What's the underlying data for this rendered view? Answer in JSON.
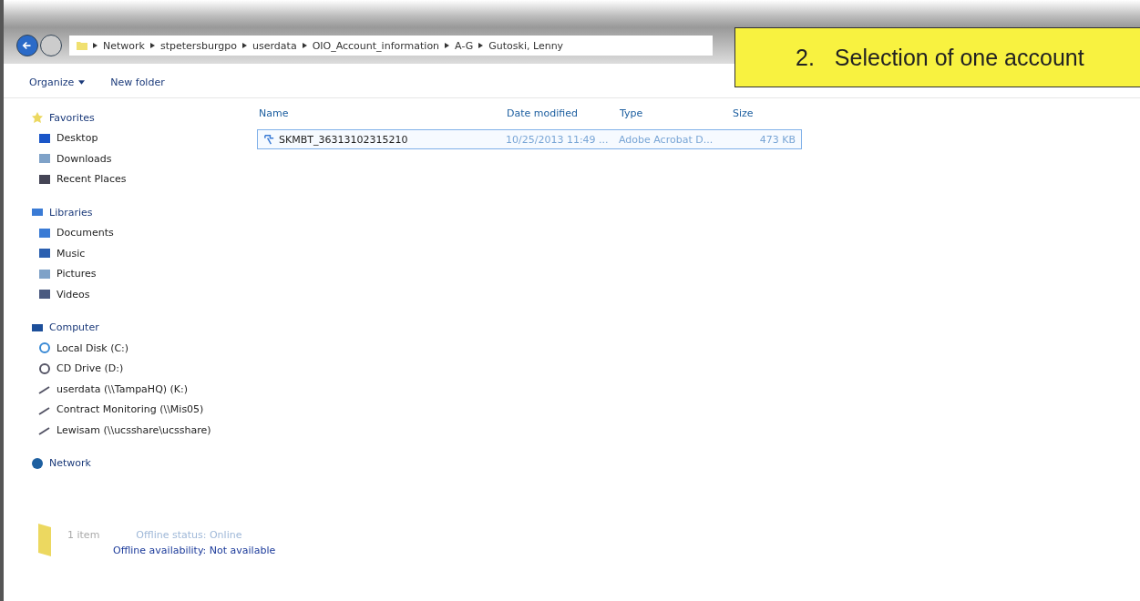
{
  "breadcrumb": [
    "Network",
    "stpetersburgpo",
    "userdata",
    "OIO_Account_information",
    "A-G",
    "Gutoski, Lenny"
  ],
  "toolbar": [
    {
      "label": "Organize",
      "kind": "menu"
    },
    {
      "label": "New folder",
      "kind": "plain"
    }
  ],
  "sidebar": [
    {
      "label": "Favorites",
      "children": [
        {
          "label": "Desktop"
        },
        {
          "label": "Downloads"
        },
        {
          "label": "Recent Places"
        }
      ]
    },
    {
      "label": "Libraries",
      "children": [
        {
          "label": "Documents"
        },
        {
          "label": "Music"
        },
        {
          "label": "Pictures"
        },
        {
          "label": "Videos"
        }
      ]
    },
    {
      "label": "Computer",
      "children": [
        {
          "label": "Local Disk (C:)"
        },
        {
          "label": "CD Drive (D:)"
        },
        {
          "label": "userdata (\\\\TampaHQ) (K:)"
        },
        {
          "label": "Contract Monitoring (\\\\Mis05)"
        },
        {
          "label": "Lewisam (\\\\ucsshare\\ucsshare)"
        }
      ]
    },
    {
      "label": "Network"
    }
  ],
  "table": {
    "columns": [
      "Name",
      "Date modified",
      "Type",
      "Size"
    ],
    "rows": [
      {
        "name": "SKMBT_36313102315210",
        "date": "10/25/2013 11:49 ...",
        "type": "Adobe Acrobat D...",
        "size": "473 KB",
        "selected": true
      }
    ]
  },
  "status_bar": {
    "count": "1 item",
    "offline_status": "Offline status: Online",
    "availability": "Offline availability: Not available"
  },
  "callout": {
    "number": "2.",
    "text": "Selection of one account"
  }
}
